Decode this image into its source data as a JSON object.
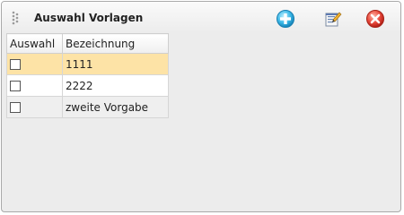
{
  "window": {
    "title": "Auswahl Vorlagen"
  },
  "toolbar": {
    "add_icon": "plus-circle-icon",
    "edit_icon": "edit-document-icon",
    "close_icon": "close-circle-icon"
  },
  "table": {
    "columns": [
      "Auswahl",
      "Bezeichnung"
    ],
    "rows": [
      {
        "checked": false,
        "name": "1111",
        "selected": true
      },
      {
        "checked": false,
        "name": "2222",
        "selected": false
      },
      {
        "checked": false,
        "name": "zweite Vorgabe",
        "selected": false
      }
    ]
  },
  "colors": {
    "selected_row": "#fde3a6",
    "panel_bg": "#ececec",
    "add_icon": "#2aa7dd",
    "close_icon": "#e03a2e"
  }
}
